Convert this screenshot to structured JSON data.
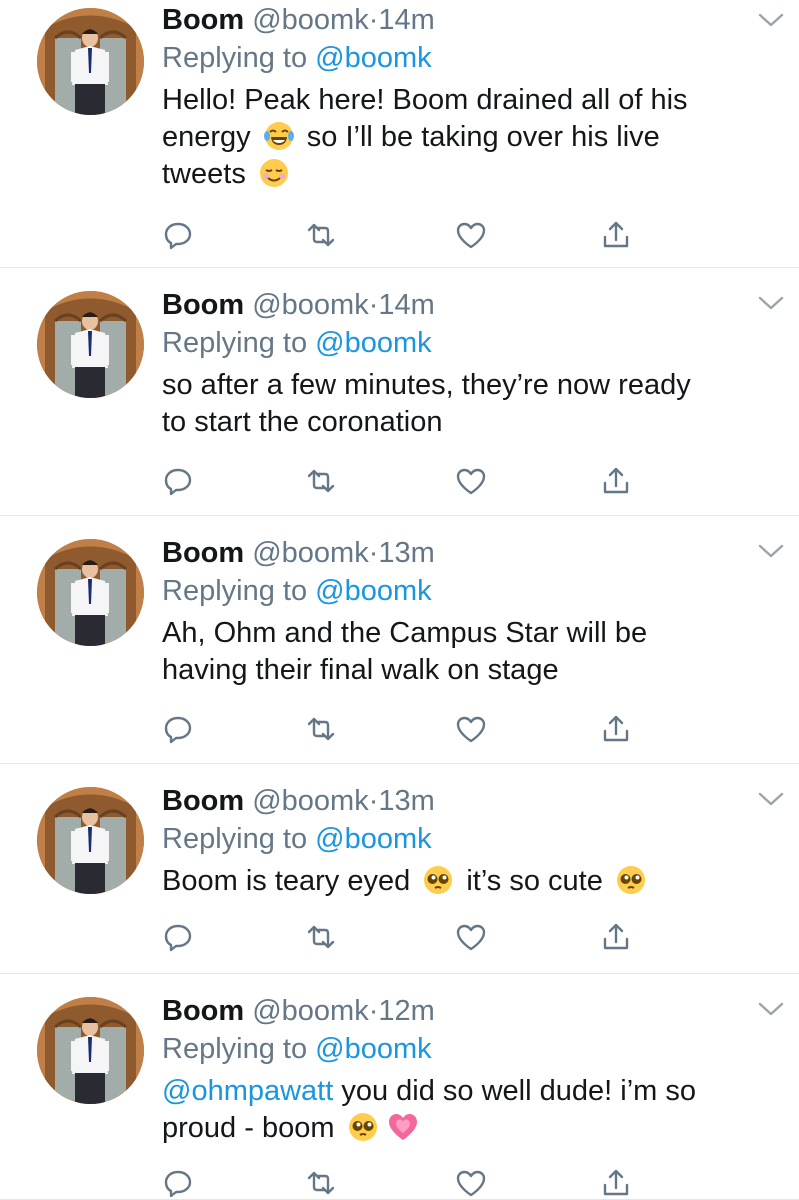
{
  "tweets": [
    {
      "name": "Boom",
      "handle": "@boomk",
      "dot": "·",
      "time": "14m",
      "replying_prefix": "Replying to",
      "replying_to": "@boomk",
      "lines": [
        {
          "parts": [
            {
              "t": "Hello! Peak here! Boom drained all of his"
            }
          ]
        },
        {
          "parts": [
            {
              "t": "energy "
            },
            {
              "emoji": "tears-of-joy-emoji"
            },
            {
              "t": " so I’ll be taking over his live"
            }
          ]
        },
        {
          "parts": [
            {
              "t": "tweets "
            },
            {
              "emoji": "smiling-face-emoji"
            }
          ]
        }
      ]
    },
    {
      "name": "Boom",
      "handle": "@boomk",
      "dot": "·",
      "time": "14m",
      "replying_prefix": "Replying to",
      "replying_to": "@boomk",
      "lines": [
        {
          "parts": [
            {
              "t": "so after a few minutes, they’re now ready"
            }
          ]
        },
        {
          "parts": [
            {
              "t": "to start the coronation"
            }
          ]
        }
      ]
    },
    {
      "name": "Boom",
      "handle": "@boomk",
      "dot": "·",
      "time": "13m",
      "replying_prefix": "Replying to",
      "replying_to": "@boomk",
      "lines": [
        {
          "parts": [
            {
              "t": "Ah, Ohm and the Campus Star will be"
            }
          ]
        },
        {
          "parts": [
            {
              "t": "having their final walk on stage"
            }
          ]
        }
      ]
    },
    {
      "name": "Boom",
      "handle": "@boomk",
      "dot": "·",
      "time": "13m",
      "replying_prefix": "Replying to",
      "replying_to": "@boomk",
      "lines": [
        {
          "parts": [
            {
              "t": "Boom is teary eyed "
            },
            {
              "emoji": "pleading-face-emoji"
            },
            {
              "t": " it’s so cute "
            },
            {
              "emoji": "pleading-face-emoji"
            }
          ]
        }
      ]
    },
    {
      "name": "Boom",
      "handle": "@boomk",
      "dot": "·",
      "time": "12m",
      "replying_prefix": "Replying to",
      "replying_to": "@boomk",
      "lines": [
        {
          "parts": [
            {
              "mention": "@ohmpawatt"
            },
            {
              "t": " you did so well dude! i’m so"
            }
          ]
        },
        {
          "parts": [
            {
              "t": "proud - boom "
            },
            {
              "emoji": "pleading-face-emoji"
            },
            {
              "emoji": "growing-heart-emoji"
            }
          ]
        }
      ]
    }
  ],
  "actions": [
    "reply-icon",
    "retweet-icon",
    "like-icon",
    "share-icon"
  ],
  "colors": {
    "text": "#14171a",
    "secondary": "#657786",
    "link": "#1b95e0",
    "divider": "#e1e8ed"
  }
}
